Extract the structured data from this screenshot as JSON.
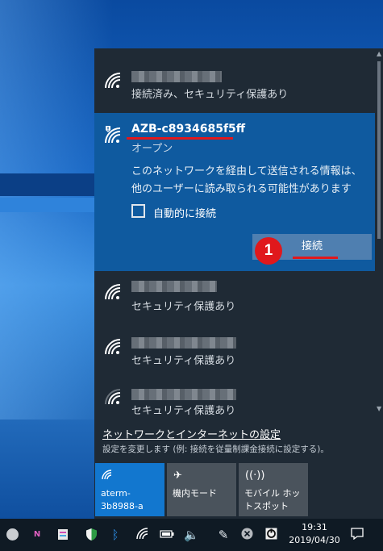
{
  "networks": {
    "connected": {
      "status": "接続済み、セキュリティ保護あり"
    },
    "selected": {
      "name": "AZB-c8934685f5ff",
      "security": "オープン",
      "warning": "このネットワークを経由して送信される情報は、他のユーザーに読み取られる可能性があります",
      "auto_connect_label": "自動的に接続",
      "auto_connect_checked": false,
      "connect_label": "接続",
      "step_number": "1"
    },
    "others": [
      {
        "status": "セキュリティ保護あり"
      },
      {
        "status": "セキュリティ保護あり"
      },
      {
        "status": "セキュリティ保護あり"
      }
    ]
  },
  "settings": {
    "link": "ネットワークとインターネットの設定",
    "description": "設定を変更します (例: 接続を従量制課金接続に設定する)。"
  },
  "quick_actions": [
    {
      "label": "aterm-3b8988-a",
      "icon": "wifi-icon",
      "active": true
    },
    {
      "label": "機内モード",
      "icon": "airplane-icon",
      "active": false
    },
    {
      "label": "モバイル ホットスポット",
      "icon": "hotspot-icon",
      "active": false
    }
  ],
  "taskbar": {
    "time": "19:31",
    "date": "2019/04/30"
  },
  "colors": {
    "accent": "#1277cf",
    "highlight": "#e0181c",
    "selected_bg": "#0f5a9f",
    "flyout_bg": "#1f2a35"
  }
}
